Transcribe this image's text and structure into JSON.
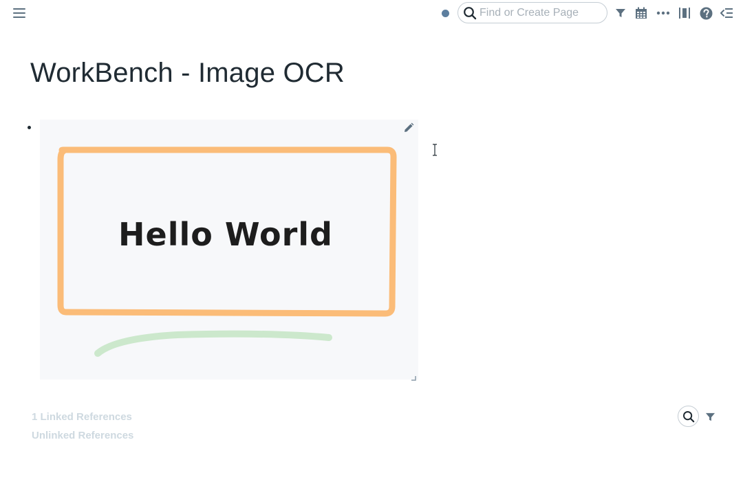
{
  "topbar": {
    "menu_icon": "hamburger-menu-icon",
    "status_color": "#5d7f9f",
    "search": {
      "placeholder": "Find or Create Page",
      "value": ""
    },
    "icons": [
      "filter-icon",
      "calendar-icon",
      "more-icon",
      "right-sidebar-icon",
      "help-icon",
      "outline-icon"
    ],
    "icon_color": "#5c7080"
  },
  "page": {
    "title": "WorkBench - Image OCR",
    "block": {
      "type": "image",
      "image_text": "Hello World",
      "frame_color": "#fbbc78",
      "underline_color": "#cce8cc"
    }
  },
  "references": {
    "linked_label": "1 Linked References",
    "unlinked_label": "Unlinked References",
    "color": "#ced9e0"
  }
}
